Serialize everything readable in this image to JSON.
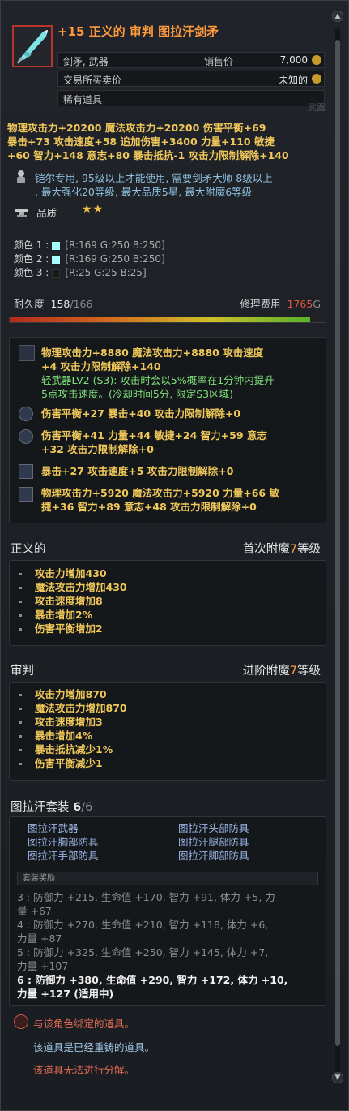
{
  "item": {
    "name": "+15 正义的 审判 图拉汗剑矛",
    "type": "剑矛, 武器",
    "sell_label": "销售价",
    "sell_value": "7,000",
    "trade_label": "交易所买卖价",
    "trade_value": "未知的",
    "rarity": "稀有道具",
    "watermark": "武器"
  },
  "stats": [
    "物理攻击力+20200  魔法攻击力+20200  伤害平衡+69",
    "暴击+73  攻击速度+58  追加伤害+3400  力量+110  敏捷",
    "+60  智力+148  意志+80  暴击抵抗-1  攻击力限制解除+140"
  ],
  "requirements": [
    "铠尔专用, 95级以上才能使用, 需要剑矛大师 8级以上",
    ", 最大强化20等级, 最大品质5星, 最大附魔6等级"
  ],
  "quality": {
    "label": "品质",
    "stars": "★★"
  },
  "colors": [
    {
      "label": "颜色 1 :",
      "swatch": "#a9fafa",
      "value": "[R:169 G:250 B:250]"
    },
    {
      "label": "颜色 2 :",
      "swatch": "#a9fafa",
      "value": "[R:169 G:250 B:250]"
    },
    {
      "label": "颜色 3 :",
      "swatch": "#191919",
      "value": "[R:25 G:25 B:25]"
    }
  ],
  "durability": {
    "label": "耐久度",
    "current": "158",
    "max": "/166",
    "fraction": 0.952
  },
  "repair": {
    "label": "修理费用",
    "value": "1765",
    "unit": "G"
  },
  "options": [
    {
      "lines": [
        "物理攻击力+8880  魔法攻击力+8880  攻击速度",
        "+4  攻击力限制解除+140"
      ],
      "extra": [
        "轻武器LV2 (S3): 攻击时会以5%概率在1分钟内提升",
        "5点攻击速度。(冷却时间5分, 限定S3区域)"
      ]
    },
    {
      "lines": [
        "伤害平衡+27  暴击+40  攻击力限制解除+0"
      ]
    },
    {
      "lines": [
        "伤害平衡+41  力量+44  敏捷+24  智力+59  意志",
        "+32  攻击力限制解除+0"
      ]
    },
    {
      "lines": [
        "暴击+27  攻击速度+5  攻击力限制解除+0"
      ]
    },
    {
      "lines": [
        "物理攻击力+5920  魔法攻击力+5920  力量+66  敏",
        "捷+36  智力+89  意志+48  攻击力限制解除+0"
      ]
    }
  ],
  "enchant1": {
    "title": "正义的",
    "right_prefix": "首次附魔",
    "level": "7",
    "right_suffix": "等级",
    "items": [
      "攻击力增加430",
      "魔法攻击力增加430",
      "攻击速度增加8",
      "暴击增加2%",
      "伤害平衡增加2"
    ]
  },
  "enchant2": {
    "title": "审判",
    "right_prefix": "进阶附魔",
    "level": "7",
    "right_suffix": "等级",
    "items": [
      "攻击力增加870",
      "魔法攻击力增加870",
      "攻击速度增加3",
      "暴击增加4%",
      "暴击抵抗减少1%",
      "伤害平衡减少1"
    ]
  },
  "set": {
    "title": "图拉汗套装",
    "count": "6",
    "total": "/6",
    "left_items": [
      "图拉汗武器",
      "图拉汗胸部防具",
      "图拉汗手部防具"
    ],
    "right_items": [
      "图拉汗头部防具",
      "图拉汗腿部防具",
      "图拉汗脚部防具"
    ],
    "bonus_header": "套装奖励",
    "bonuses": [
      "3 : 防御力 +215, 生命值 +170, 智力 +91, 体力 +5, 力",
      "量 +67",
      "4 : 防御力 +270, 生命值 +210, 智力 +118, 体力 +6,",
      "力量 +87",
      "5 : 防御力 +325, 生命值 +250, 智力 +145, 体力 +7,",
      "力量 +107",
      "6 : 防御力 +380, 生命值 +290, 智力 +172, 体力 +10,",
      "力量 +127 (适用中)"
    ]
  },
  "footer": {
    "bound": "与该角色绑定的道具。",
    "reforged": "该道具是已经重铸的道具。",
    "no_split": "该道具无法进行分解。"
  }
}
